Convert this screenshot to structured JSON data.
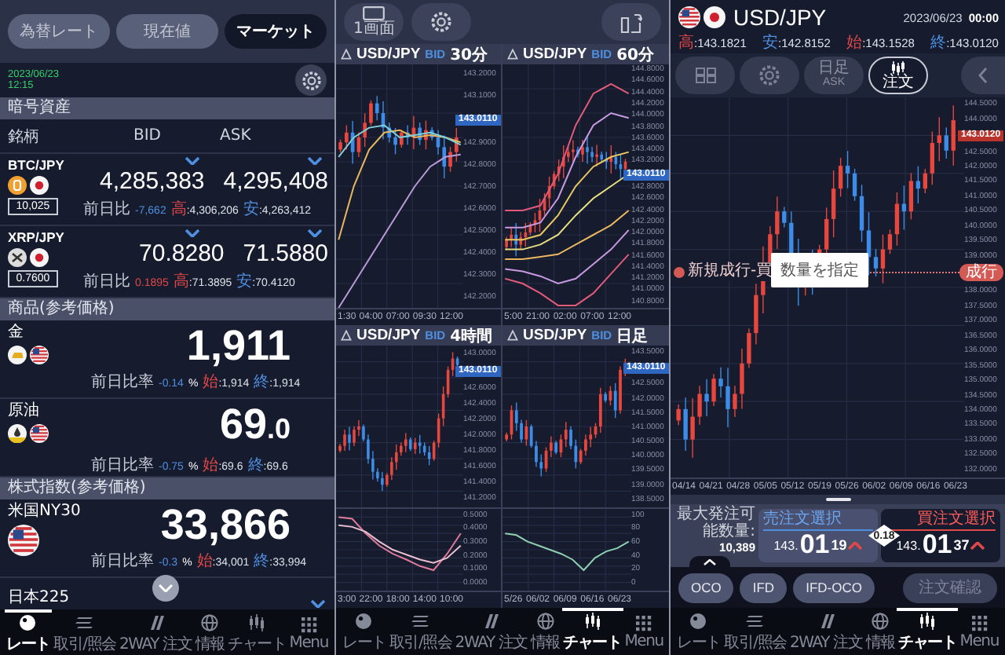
{
  "market_screen": {
    "tabs": [
      {
        "label": "為替レート",
        "selected": false
      },
      {
        "label": "現在値",
        "selected": false
      },
      {
        "label": "マーケット",
        "selected": true
      }
    ],
    "date": "2023/06/23",
    "time": "12:15",
    "crypto": {
      "title": "暗号資産",
      "columns": [
        "銘柄",
        "BID",
        "ASK"
      ],
      "rows": [
        {
          "symbol": "BTC/JPY",
          "kind": "bitcoin",
          "unit": "10,025",
          "bid": "4,285,383",
          "ask": "4,295,408",
          "bid_falling": true,
          "ask_falling": true,
          "change_label": "前日比",
          "change": "-7,662",
          "change_rising": false,
          "high_label": "高",
          "high": ":4,306,206",
          "low_label": "安",
          "low": ":4,263,412"
        },
        {
          "symbol": "XRP/JPY",
          "kind": "ripple",
          "unit": "0.7600",
          "bid": "70.8280",
          "ask": "71.5880",
          "bid_falling": true,
          "ask_falling": true,
          "change_label": "前日比",
          "change": "0.1895",
          "change_rising": true,
          "high_label": "高",
          "high": ":71.3895",
          "low_label": "安",
          "low": ":70.4120"
        }
      ]
    },
    "commodities": {
      "title": "商品(参考価格)",
      "rows": [
        {
          "name": "金",
          "kind": "gold",
          "price": "1,911",
          "change_label": "前日比率",
          "change": "-0.14",
          "change_unit": "%",
          "change_rising": false,
          "open_label": "始",
          "open": ":1,914",
          "close_label": "終",
          "close": ":1,914"
        },
        {
          "name": "原油",
          "kind": "oil",
          "price": "69",
          "price_decimal": ".0",
          "change_label": "前日比率",
          "change": "-0.75",
          "change_unit": "%",
          "change_rising": false,
          "open_label": "始",
          "open": ":69.6",
          "close_label": "終",
          "close": ":69.6"
        }
      ]
    },
    "indices": {
      "title": "株式指数(参考価格)",
      "rows": [
        {
          "name": "米国NY30",
          "kind": "usindex",
          "price": "33,866",
          "change_label": "前日比率",
          "change": "-0.3",
          "change_unit": "%",
          "change_rising": false,
          "open_label": "始",
          "open": ":34,001",
          "close_label": "終",
          "close": ":33,994"
        },
        {
          "name": "日本225",
          "falling": true
        }
      ]
    },
    "bottom_nav": [
      {
        "label": "レート",
        "selected": true
      },
      {
        "label": "取引/照会",
        "selected": false
      },
      {
        "label": "2WAY 注文",
        "selected": false
      },
      {
        "label": "情報",
        "selected": false
      },
      {
        "label": "チャート",
        "selected": false
      },
      {
        "label": "Menu",
        "selected": false
      }
    ]
  },
  "multi_chart_screen": {
    "layout_button": "1画面",
    "charts": [
      {
        "pair": "USD/JPY",
        "side": "BID",
        "timeframe": "30分",
        "price_tag": "143.0110",
        "y_axis_labels": [
          "143.2000",
          "143.1000",
          "142.9000",
          "142.8000",
          "142.7000",
          "142.6000",
          "142.5000",
          "142.4000",
          "142.3000",
          "142.2000"
        ],
        "x_axis_labels": [
          "1:30",
          "04:00",
          "07:00",
          "09:30",
          "12:00"
        ]
      },
      {
        "pair": "USD/JPY",
        "side": "BID",
        "timeframe": "60分",
        "price_tag": "143.0110",
        "y_axis_labels": [
          "144.8000",
          "144.6000",
          "144.4000",
          "144.2000",
          "144.0000",
          "143.8000",
          "143.6000",
          "143.4000",
          "143.2000",
          "142.8000",
          "142.6000",
          "142.4000",
          "142.2000",
          "142.0000",
          "141.8000",
          "141.6000",
          "141.4000",
          "141.2000",
          "141.0000",
          "140.8000"
        ],
        "x_axis_labels": [
          "5:00",
          "21:00",
          "02:00",
          "07:00",
          "12:00"
        ]
      },
      {
        "pair": "USD/JPY",
        "side": "BID",
        "timeframe": "4時間",
        "price_tag": "143.0110",
        "y_axis_labels": [
          "143.0000",
          "142.6000",
          "142.4000",
          "142.2000",
          "142.0000",
          "141.8000",
          "141.6000",
          "141.4000",
          "141.2000"
        ],
        "sub_y_axis_labels": [
          "0.5000",
          "0.4000",
          "0.3000",
          "0.2000",
          "0.1000",
          "0.0000"
        ],
        "x_axis_labels": [
          "3:00",
          "22:00",
          "18:00",
          "14:00",
          "10:00"
        ]
      },
      {
        "pair": "USD/JPY",
        "side": "BID",
        "timeframe": "日足",
        "price_tag": "143.0110",
        "y_axis_labels": [
          "143.5000",
          "142.5000",
          "142.0000",
          "141.5000",
          "141.0000",
          "140.5000",
          "140.0000",
          "139.5000",
          "139.0000",
          "138.5000"
        ],
        "sub_y_axis_labels": [
          "100",
          "80",
          "60",
          "40",
          "20",
          "0"
        ],
        "x_axis_labels": [
          "5/26",
          "06/02",
          "06/09",
          "06/16",
          "06/23"
        ]
      }
    ],
    "bottom_nav": [
      {
        "label": "レート",
        "selected": false
      },
      {
        "label": "取引/照会",
        "selected": false
      },
      {
        "label": "2WAY 注文",
        "selected": false
      },
      {
        "label": "情報",
        "selected": false
      },
      {
        "label": "チャート",
        "selected": true
      },
      {
        "label": "Menu",
        "selected": false
      }
    ]
  },
  "order_chart_screen": {
    "pair": "USD/JPY",
    "date": "2023/06/23",
    "time": "00:00",
    "quotes": [
      {
        "label": "高",
        "value": ":143.1821",
        "kind": "high"
      },
      {
        "label": "安",
        "value": ":142.8152",
        "kind": "low"
      },
      {
        "label": "始",
        "value": ":143.1528",
        "kind": "open"
      },
      {
        "label": "終",
        "value": ":143.0120",
        "kind": "close"
      }
    ],
    "toolbar": [
      {
        "kind": "layout",
        "selected": false
      },
      {
        "kind": "settings",
        "selected": false
      },
      {
        "kind": "text",
        "label": "日足",
        "sublabel": "ASK",
        "selected": false
      },
      {
        "kind": "order",
        "label": "注文",
        "selected": true
      },
      {
        "kind": "back",
        "selected": false
      }
    ],
    "chart": {
      "price_tag": "143.0120",
      "y_axis_labels": [
        "144.5000",
        "144.0000",
        "142.5000",
        "142.0000",
        "141.5000",
        "141.0000",
        "140.5000",
        "140.0000",
        "139.5000",
        "139.0000",
        "138.0000",
        "137.5000",
        "137.0000",
        "136.5000",
        "136.0000",
        "135.5000",
        "135.0000",
        "134.5000",
        "134.0000",
        "133.5000",
        "133.0000",
        "132.5000",
        "132.0000"
      ],
      "x_axis_labels": [
        "04/14",
        "04/21",
        "04/28",
        "05/05",
        "05/12",
        "05/19",
        "05/26",
        "06/02",
        "06/09",
        "06/16",
        "06/23"
      ],
      "order_line_label": "新規成行-買",
      "order_line_tag": "成行",
      "popup": "数量を指定"
    },
    "order_panel": {
      "max_label": "最大発注可能数量:",
      "max_value": "10,389",
      "sell": {
        "label": "売注文選択",
        "price_head": "143.",
        "price_big": "01",
        "price_tail": "19",
        "rising": true,
        "selected": false
      },
      "spread": "0.18",
      "buy": {
        "label": "買注文選択",
        "price_head": "143.",
        "price_big": "01",
        "price_tail": "37",
        "rising": true,
        "selected": true
      }
    },
    "order_types": [
      {
        "label": "OCO",
        "disabled": false
      },
      {
        "label": "IFD",
        "disabled": false
      },
      {
        "label": "IFD-OCO",
        "disabled": false
      }
    ],
    "confirm": {
      "label": "注文確認",
      "disabled": true
    },
    "bottom_nav": [
      {
        "label": "レート",
        "selected": false
      },
      {
        "label": "取引/照会",
        "selected": false
      },
      {
        "label": "2WAY 注文",
        "selected": false
      },
      {
        "label": "情報",
        "selected": false
      },
      {
        "label": "チャート",
        "selected": true
      },
      {
        "label": "Menu",
        "selected": false
      }
    ]
  }
}
